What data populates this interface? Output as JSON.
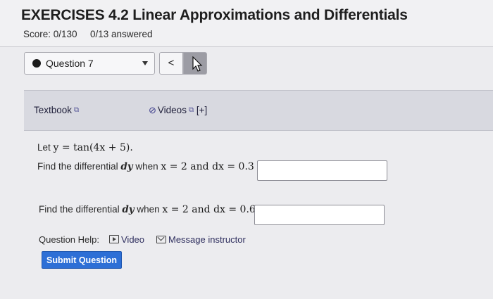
{
  "header": {
    "title": "EXERCISES 4.2 Linear Approximations and Differentials",
    "score": "Score: 0/130",
    "answered": "0/13 answered"
  },
  "question_nav": {
    "selected": "Question 7",
    "prev_label": "<",
    "next_label": ">"
  },
  "toolbar": {
    "textbook_label": "Textbook",
    "videos_label": "Videos",
    "videos_expand": "[+]"
  },
  "problem": {
    "intro_prefix": "Let ",
    "function": "y = tan(4x + 5).",
    "part1_prefix": "Find the differential ",
    "part1_dy": "dy",
    "part1_when": " when ",
    "part1_condition": "x = 2 and dx = 0.3",
    "part1_answer": "",
    "part2_prefix": "Find the differential ",
    "part2_dy": "dy",
    "part2_when": " when ",
    "part2_condition": "x = 2 and dx = 0.6",
    "part2_answer": ""
  },
  "help": {
    "label": "Question Help:",
    "video_label": "Video",
    "message_label": "Message instructor"
  },
  "submit_label": "Submit Question",
  "colors": {
    "submit_bg": "#2d6fd6",
    "toolbar_bg": "#d8d9e0",
    "page_bg": "#ececef"
  }
}
